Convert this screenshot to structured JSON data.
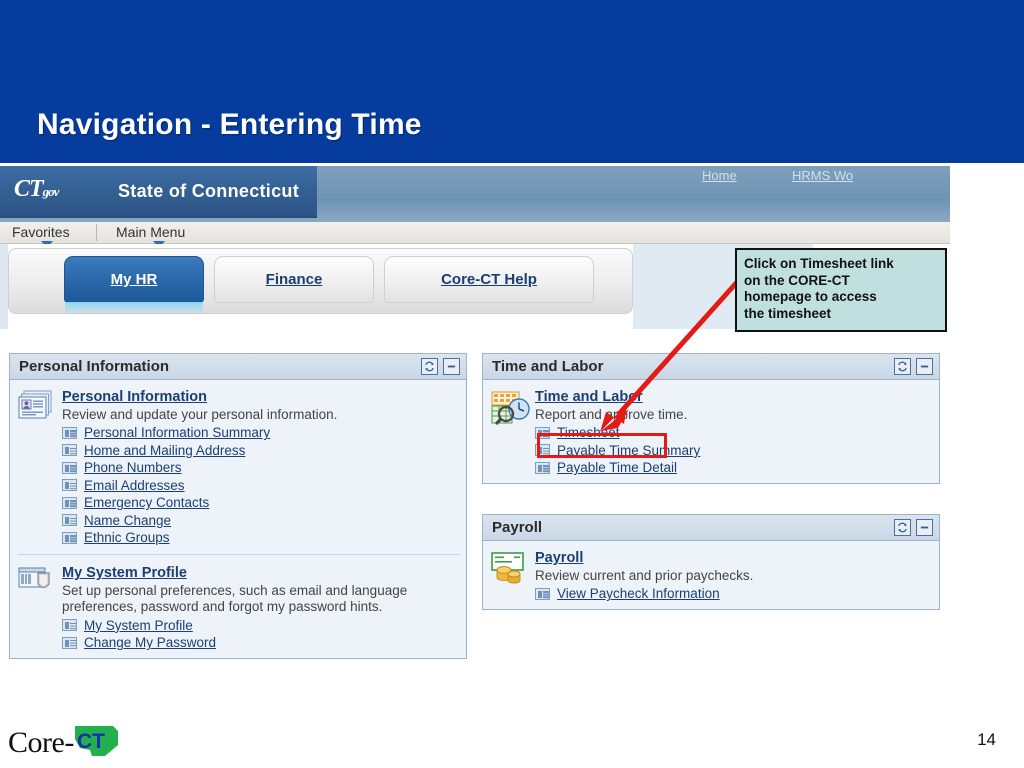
{
  "slide": {
    "title": "Navigation - Entering Time",
    "page_number": "14",
    "banner_color": "#063c9e",
    "footer_logo": {
      "word": "Core-",
      "mark": "CT"
    }
  },
  "portal": {
    "brand": {
      "logo": "CT",
      "logo_sub": "gov",
      "name": "State of Connecticut"
    },
    "top_links": [
      {
        "label": "Home"
      },
      {
        "label": "HRMS Wo"
      }
    ],
    "menu": [
      {
        "label": "Favorites"
      },
      {
        "label": "Main Menu"
      }
    ],
    "tabs": [
      {
        "label": "My HR",
        "selected": true
      },
      {
        "label": "Finance",
        "selected": false
      },
      {
        "label": "Core-CT Help",
        "selected": false
      }
    ]
  },
  "pagelets": {
    "personal_information": {
      "header": "Personal Information",
      "refresh_label": "Refresh",
      "minimize_label": "Minimize",
      "entries": [
        {
          "title": "Personal Information",
          "description": "Review and update your personal information.",
          "icon": "id-cards-icon",
          "links": [
            "Personal Information Summary",
            "Home and Mailing Address",
            "Phone Numbers",
            "Email Addresses",
            "Emergency Contacts",
            "Name Change",
            "Ethnic Groups"
          ]
        },
        {
          "title": "My System Profile",
          "description": "Set up personal preferences, such as email and language preferences, password and forgot my password hints.",
          "icon": "shield-icon",
          "links": [
            "My System Profile",
            "Change My Password"
          ]
        }
      ]
    },
    "time_and_labor": {
      "header": "Time and Labor",
      "refresh_label": "Refresh",
      "minimize_label": "Minimize",
      "entries": [
        {
          "title": "Time and Labor",
          "description": "Report and approve time.",
          "icon": "calendar-clock-search-icon",
          "links": [
            "Timesheet",
            "Payable Time Summary",
            "Payable Time Detail"
          ]
        }
      ]
    },
    "payroll": {
      "header": "Payroll",
      "refresh_label": "Refresh",
      "minimize_label": "Minimize",
      "entries": [
        {
          "title": "Payroll",
          "description": "Review current and prior paychecks.",
          "icon": "paycheck-coins-icon",
          "links": [
            "View Paycheck Information"
          ]
        }
      ]
    }
  },
  "annotation": {
    "callout_lines": [
      "Click on Timesheet link",
      "on the CORE-CT",
      "homepage to access",
      "the timesheet"
    ],
    "callout_fill": "#bfe0de",
    "highlight_color": "#e31b17",
    "arrow_color": "#e31b17",
    "highlight_target": "Timesheet"
  }
}
